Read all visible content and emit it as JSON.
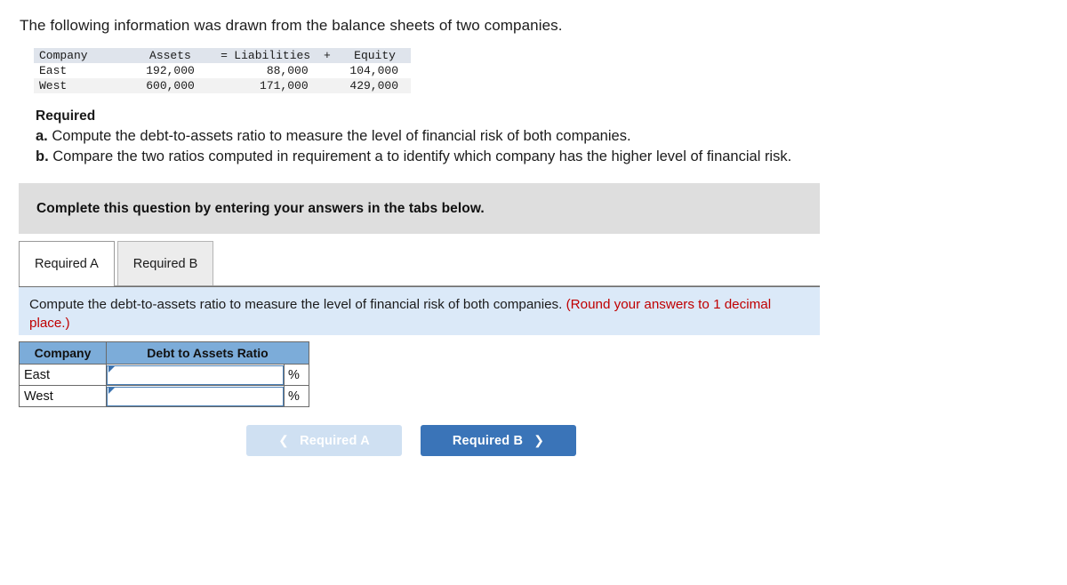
{
  "intro": "The following information was drawn from the balance sheets of two companies.",
  "balance_sheet": {
    "headers": {
      "company": "Company",
      "assets": "Assets",
      "equals": "=",
      "liabilities": "Liabilities",
      "plus": "+",
      "equity": "Equity"
    },
    "rows": [
      {
        "company": "East",
        "assets": "192,000",
        "liabilities": "88,000",
        "equity": "104,000"
      },
      {
        "company": "West",
        "assets": "600,000",
        "liabilities": "171,000",
        "equity": "429,000"
      }
    ]
  },
  "required": {
    "title": "Required",
    "items": [
      {
        "marker": "a.",
        "text": "Compute the debt-to-assets ratio to measure the level of financial risk of both companies."
      },
      {
        "marker": "b.",
        "text": "Compare the two ratios computed in requirement a to identify which company has the higher level of financial risk."
      }
    ]
  },
  "banner": {
    "text": "Complete this question by entering your answers in the tabs below."
  },
  "tabs": [
    {
      "label": "Required A",
      "active": true
    },
    {
      "label": "Required B",
      "active": false
    }
  ],
  "panel": {
    "instruction": "Compute the debt-to-assets ratio to measure the level of financial risk of both companies.",
    "note": "(Round your answers to 1 decimal place.)"
  },
  "answer_table": {
    "headers": {
      "company": "Company",
      "ratio": "Debt to Assets Ratio"
    },
    "percent_symbol": "%",
    "rows": [
      {
        "company": "East",
        "value": "",
        "placeholder": ""
      },
      {
        "company": "West",
        "value": "",
        "placeholder": ""
      }
    ]
  },
  "nav": {
    "prev_label": "Required A",
    "next_label": "Required B",
    "prev_icon": "chevron-left-icon",
    "next_icon": "chevron-right-icon"
  },
  "colors": {
    "header_blue": "#7cacd9",
    "panel_blue": "#dbe9f8",
    "banner_gray": "#dedede",
    "button_blue": "#3a74b8",
    "button_disabled": "#cfe0f2",
    "note_red": "#c00000"
  }
}
